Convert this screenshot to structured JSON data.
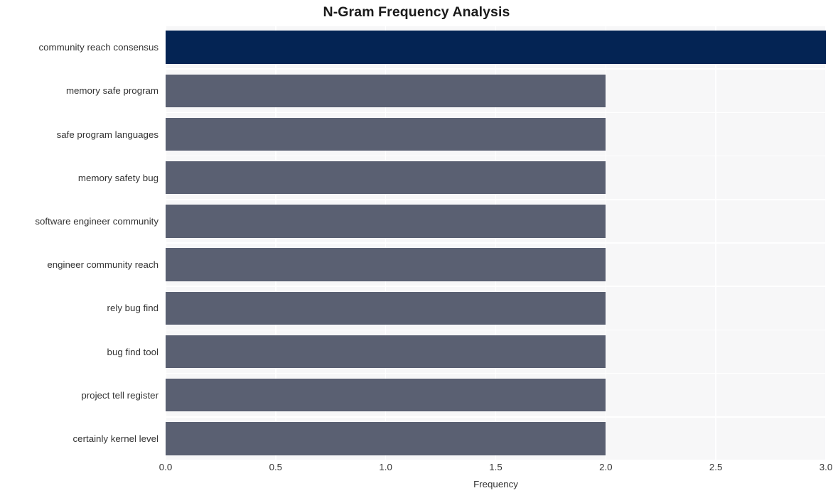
{
  "chart_data": {
    "type": "bar",
    "orientation": "horizontal",
    "title": "N-Gram Frequency Analysis",
    "xlabel": "Frequency",
    "ylabel": "",
    "xlim": [
      0.0,
      3.0
    ],
    "xticks": [
      "0.0",
      "0.5",
      "1.0",
      "1.5",
      "2.0",
      "2.5",
      "3.0"
    ],
    "xtick_values": [
      0.0,
      0.5,
      1.0,
      1.5,
      2.0,
      2.5,
      3.0
    ],
    "grid": true,
    "legend": "none",
    "categories": [
      "community reach consensus",
      "memory safe program",
      "safe program languages",
      "memory safety bug",
      "software engineer community",
      "engineer community reach",
      "rely bug find",
      "bug find tool",
      "project tell register",
      "certainly kernel level"
    ],
    "values": [
      3,
      2,
      2,
      2,
      2,
      2,
      2,
      2,
      2,
      2
    ],
    "bar_colors": [
      "#042454",
      "#5a6072",
      "#5a6072",
      "#5a6072",
      "#5a6072",
      "#5a6072",
      "#5a6072",
      "#5a6072",
      "#5a6072",
      "#5a6072"
    ]
  },
  "style": {
    "plot_background": "#f7f7f8",
    "grid_color": "#ffffff",
    "page_background": "#ffffff",
    "text_color": "#333333",
    "title_color": "#1a1a1a",
    "highlight_color": "#042454",
    "bar_color": "#5a6072"
  }
}
